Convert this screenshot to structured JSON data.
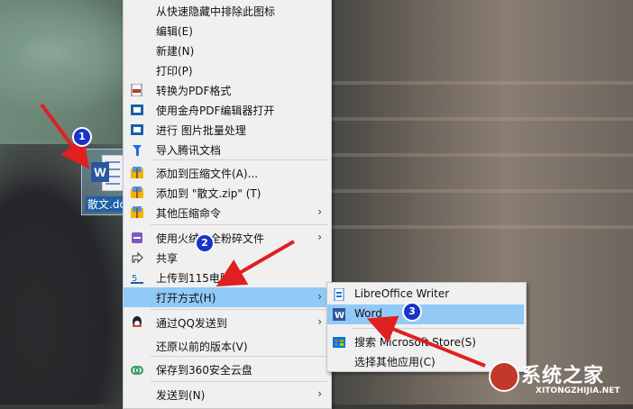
{
  "file": {
    "name": "散文.docx",
    "label": "散文.dc"
  },
  "steps": [
    "1",
    "2",
    "3"
  ],
  "menu": [
    {
      "label": "从快速隐藏中排除此图标",
      "icon": "none"
    },
    {
      "label": "编辑(E)",
      "icon": "none"
    },
    {
      "label": "新建(N)",
      "icon": "none"
    },
    {
      "label": "打印(P)",
      "icon": "none"
    },
    {
      "label": "转换为PDF格式",
      "icon": "pdf-icon"
    },
    {
      "label": "使用金舟PDF编辑器打开",
      "icon": "pdf-editor-icon"
    },
    {
      "label": "进行 图片批量处理",
      "icon": "image-batch-icon"
    },
    {
      "label": "导入腾讯文档",
      "icon": "tencent-docs-icon"
    },
    {
      "label": "添加到压缩文件(A)...",
      "icon": "archive-icon"
    },
    {
      "label": "添加到 \"散文.zip\" (T)",
      "icon": "archive-icon"
    },
    {
      "label": "其他压缩命令",
      "icon": "archive-icon",
      "submenu": true
    },
    {
      "label": "使用火绒安全粉碎文件",
      "icon": "shred-icon",
      "submenu": true
    },
    {
      "label": "共享",
      "icon": "share-icon"
    },
    {
      "label": "上传到115电脑版",
      "icon": "upload-115-icon"
    },
    {
      "label": "打开方式(H)",
      "icon": "none",
      "submenu": true,
      "highlight": true
    },
    {
      "label": "通过QQ发送到",
      "icon": "qq-icon",
      "submenu": true
    },
    {
      "label": "还原以前的版本(V)",
      "icon": "none"
    },
    {
      "label": "保存到360安全云盘",
      "icon": "cloud-360-icon"
    },
    {
      "label": "发送到(N)",
      "icon": "none",
      "submenu": true
    }
  ],
  "open_with": [
    {
      "label": "LibreOffice Writer",
      "icon": "libreoffice-icon"
    },
    {
      "label": "Word",
      "icon": "word-icon",
      "highlight": true
    },
    {
      "label": "搜索 Microsoft Store(S)",
      "icon": "store-icon"
    },
    {
      "label": "选择其他应用(C)",
      "icon": "none"
    }
  ],
  "watermark": {
    "main": "系统之家",
    "url": "XITONGZHIJIA.NET"
  },
  "colors": {
    "highlight": "#91c9f7",
    "annotation_arrow": "#e02020",
    "step_badge": "#1833c8",
    "word_blue": "#2b579a"
  }
}
